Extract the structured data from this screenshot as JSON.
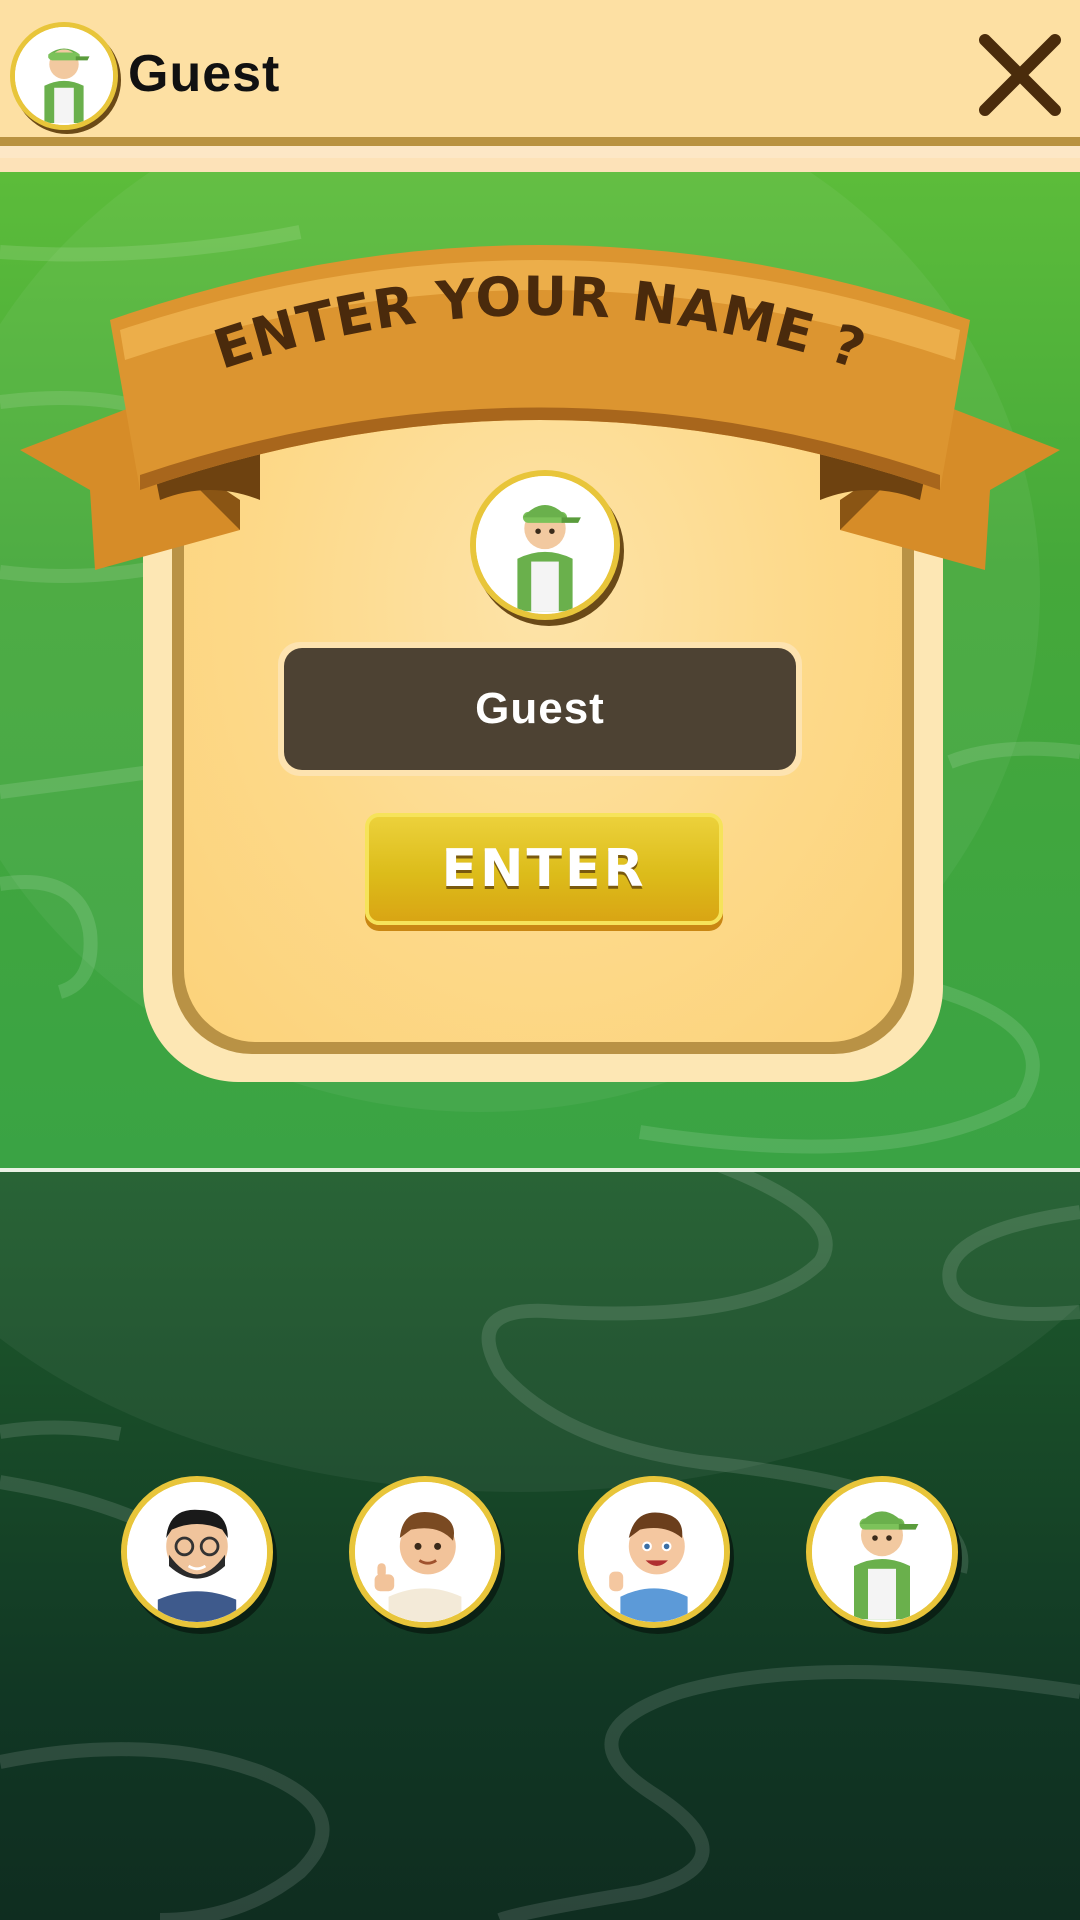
{
  "header": {
    "player_name": "Guest",
    "avatar_icon": "boy-green-cap-avatar",
    "close_icon": "close-x-icon"
  },
  "dialog": {
    "title": "ENTER YOUR NAME ?",
    "selected_avatar": "boy-green-cap-avatar",
    "name_input_value": "Guest",
    "enter_label": "ENTER"
  },
  "avatars": [
    {
      "icon": "bearded-man-glasses-avatar"
    },
    {
      "icon": "boy-thumbs-up-avatar"
    },
    {
      "icon": "boy-blue-shirt-avatar"
    },
    {
      "icon": "boy-green-cap-avatar"
    }
  ],
  "colors": {
    "header_bg": "#fde0a3",
    "green_top": "#4cae3b",
    "green_bottom": "#133a25",
    "ribbon": "#d9922f",
    "panel": "#fdd989",
    "input_bg": "#4d4233",
    "enter_button": "#dcbc1a",
    "avatar_ring": "#e8c53a"
  }
}
